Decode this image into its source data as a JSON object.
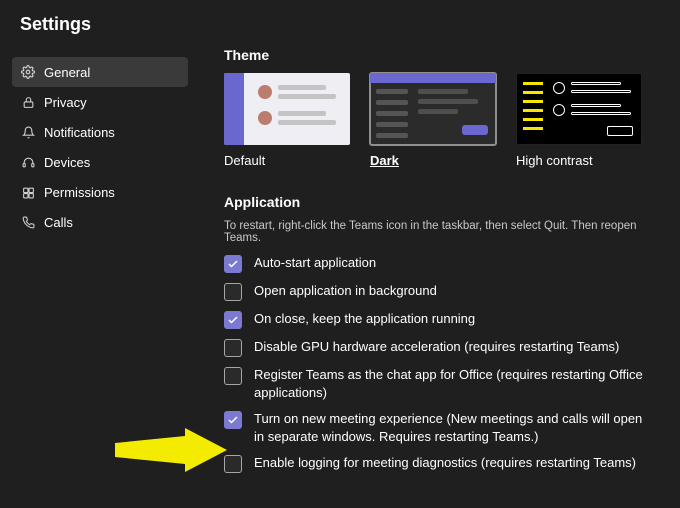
{
  "title": "Settings",
  "sidebar": {
    "items": [
      {
        "label": "General",
        "icon": "gear-icon",
        "active": true
      },
      {
        "label": "Privacy",
        "icon": "lock-icon",
        "active": false
      },
      {
        "label": "Notifications",
        "icon": "bell-icon",
        "active": false
      },
      {
        "label": "Devices",
        "icon": "headset-icon",
        "active": false
      },
      {
        "label": "Permissions",
        "icon": "permissions-icon",
        "active": false
      },
      {
        "label": "Calls",
        "icon": "phone-icon",
        "active": false
      }
    ]
  },
  "theme": {
    "heading": "Theme",
    "options": [
      {
        "label": "Default",
        "selected": false
      },
      {
        "label": "Dark",
        "selected": true
      },
      {
        "label": "High contrast",
        "selected": false
      }
    ]
  },
  "application": {
    "heading": "Application",
    "hint": "To restart, right-click the Teams icon in the taskbar, then select Quit. Then reopen Teams.",
    "options": [
      {
        "label": "Auto-start application",
        "checked": true
      },
      {
        "label": "Open application in background",
        "checked": false
      },
      {
        "label": "On close, keep the application running",
        "checked": true
      },
      {
        "label": "Disable GPU hardware acceleration (requires restarting Teams)",
        "checked": false
      },
      {
        "label": "Register Teams as the chat app for Office (requires restarting Office applications)",
        "checked": false
      },
      {
        "label": "Turn on new meeting experience (New meetings and calls will open in separate windows. Requires restarting Teams.)",
        "checked": true
      },
      {
        "label": "Enable logging for meeting diagnostics (requires restarting Teams)",
        "checked": false
      }
    ]
  },
  "colors": {
    "accent": "#7b79d1",
    "arrow": "#f3eb00"
  }
}
